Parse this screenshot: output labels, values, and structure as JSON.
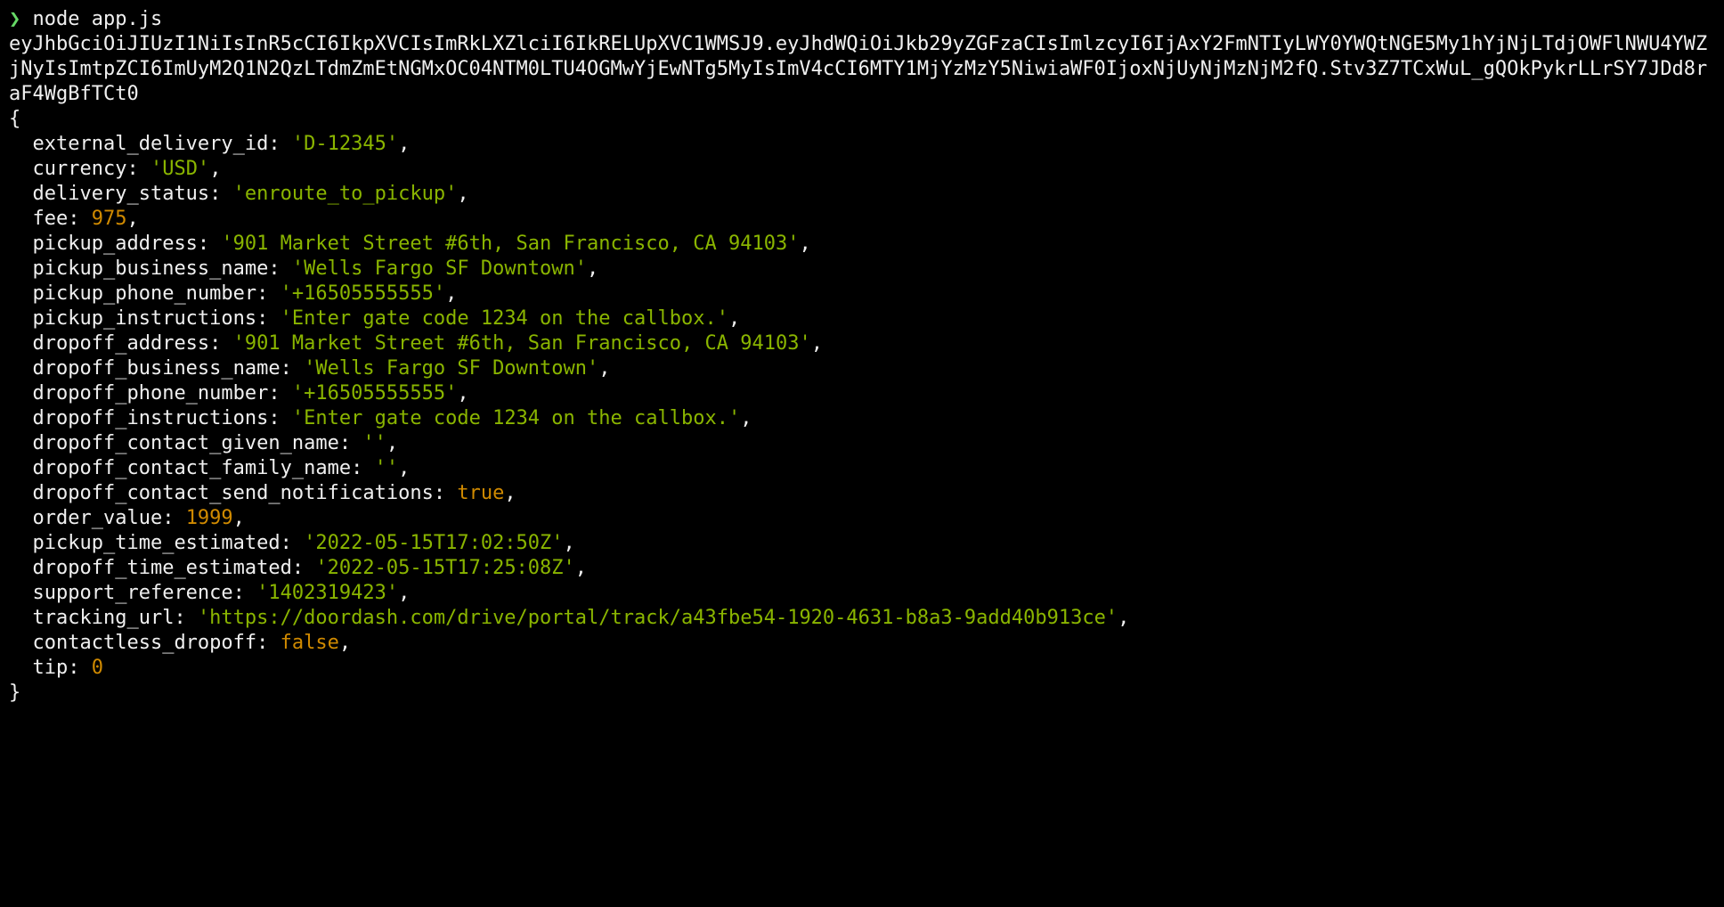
{
  "prompt_char": "❯",
  "command": "node app.js",
  "jwt": "eyJhbGciOiJIUzI1NiIsInR5cCI6IkpXVCIsImRkLXZlciI6IkRELUpXVC1WMSJ9.eyJhdWQiOiJkb29yZGFzaCIsImlzcyI6IjAxY2FmNTIyLWY0YWQtNGE5My1hYjNjLTdjOWFlNWU4YWZjNyIsImtpZCI6ImUyM2Q1N2QzLTdmZmEtNGMxOC04NTM0LTU4OGMwYjEwNTg5MyIsImV4cCI6MTY1MjYzMzY5NiwiaWF0IjoxNjUyNjMzNjM2fQ.Stv3Z7TCxWuL_gQOkPykrLLrSY7JDd8raF4WgBfTCt0",
  "open_brace": "{",
  "close_brace": "}",
  "fields": [
    {
      "key": "external_delivery_id",
      "val": "'D-12345'",
      "cls": "str",
      "trail": ","
    },
    {
      "key": "currency",
      "val": "'USD'",
      "cls": "str",
      "trail": ","
    },
    {
      "key": "delivery_status",
      "val": "'enroute_to_pickup'",
      "cls": "str",
      "trail": ","
    },
    {
      "key": "fee",
      "val": "975",
      "cls": "num",
      "trail": ","
    },
    {
      "key": "pickup_address",
      "val": "'901 Market Street #6th, San Francisco, CA 94103'",
      "cls": "str",
      "trail": ","
    },
    {
      "key": "pickup_business_name",
      "val": "'Wells Fargo SF Downtown'",
      "cls": "str",
      "trail": ","
    },
    {
      "key": "pickup_phone_number",
      "val": "'+16505555555'",
      "cls": "str",
      "trail": ","
    },
    {
      "key": "pickup_instructions",
      "val": "'Enter gate code 1234 on the callbox.'",
      "cls": "str",
      "trail": ","
    },
    {
      "key": "dropoff_address",
      "val": "'901 Market Street #6th, San Francisco, CA 94103'",
      "cls": "str",
      "trail": ","
    },
    {
      "key": "dropoff_business_name",
      "val": "'Wells Fargo SF Downtown'",
      "cls": "str",
      "trail": ","
    },
    {
      "key": "dropoff_phone_number",
      "val": "'+16505555555'",
      "cls": "str",
      "trail": ","
    },
    {
      "key": "dropoff_instructions",
      "val": "'Enter gate code 1234 on the callbox.'",
      "cls": "str",
      "trail": ","
    },
    {
      "key": "dropoff_contact_given_name",
      "val": "''",
      "cls": "str",
      "trail": ","
    },
    {
      "key": "dropoff_contact_family_name",
      "val": "''",
      "cls": "str",
      "trail": ","
    },
    {
      "key": "dropoff_contact_send_notifications",
      "val": "true",
      "cls": "bool-true",
      "trail": ","
    },
    {
      "key": "order_value",
      "val": "1999",
      "cls": "num",
      "trail": ","
    },
    {
      "key": "pickup_time_estimated",
      "val": "'2022-05-15T17:02:50Z'",
      "cls": "str",
      "trail": ","
    },
    {
      "key": "dropoff_time_estimated",
      "val": "'2022-05-15T17:25:08Z'",
      "cls": "str",
      "trail": ","
    },
    {
      "key": "support_reference",
      "val": "'1402319423'",
      "cls": "str",
      "trail": ","
    },
    {
      "key": "tracking_url",
      "val": "'https://doordash.com/drive/portal/track/a43fbe54-1920-4631-b8a3-9add40b913ce'",
      "cls": "str",
      "trail": ","
    },
    {
      "key": "contactless_dropoff",
      "val": "false",
      "cls": "bool-false",
      "trail": ","
    },
    {
      "key": "tip",
      "val": "0",
      "cls": "num",
      "trail": ""
    }
  ]
}
